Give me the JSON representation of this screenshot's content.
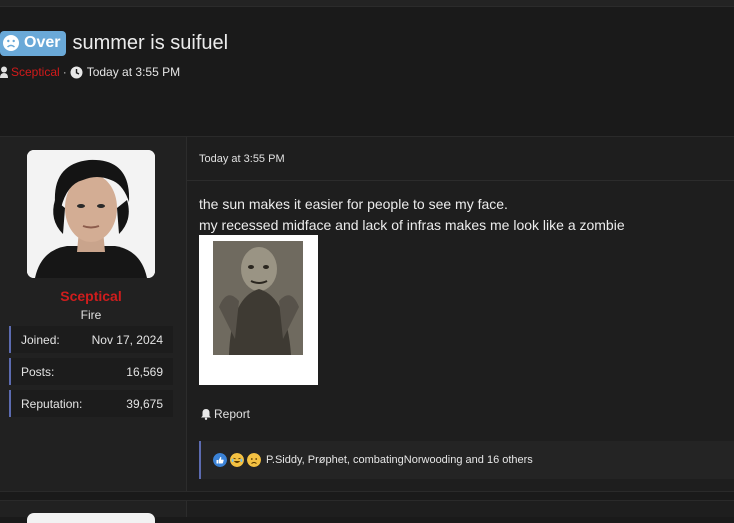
{
  "thread": {
    "prefix_label": "Over",
    "title": "summer is suifuel",
    "author": "Sceptical",
    "separator": "·",
    "date": "Today at 3:55 PM"
  },
  "post": {
    "user": {
      "name": "Sceptical",
      "title": "Fire",
      "stats": [
        {
          "label": "Joined:",
          "value": "Nov 17, 2024"
        },
        {
          "label": "Posts:",
          "value": "16,569"
        },
        {
          "label": "Reputation:",
          "value": "39,675"
        }
      ]
    },
    "date": "Today at 3:55 PM",
    "body_lines": [
      "the sun makes it easier for people to see my face.",
      "my recessed midface and lack of infras makes me look like a zombie"
    ],
    "report_label": "Report",
    "reactions": {
      "icons": [
        "like-icon",
        "laugh-icon",
        "sad-icon"
      ],
      "text": "P.Siddy, Prøphet, combatingNorwooding and 16 others"
    }
  },
  "colors": {
    "background": "#1a1a1a",
    "prefix": "#6aa9d8",
    "username": "#cf1d1d",
    "accent_border": "#5c6bb0"
  }
}
